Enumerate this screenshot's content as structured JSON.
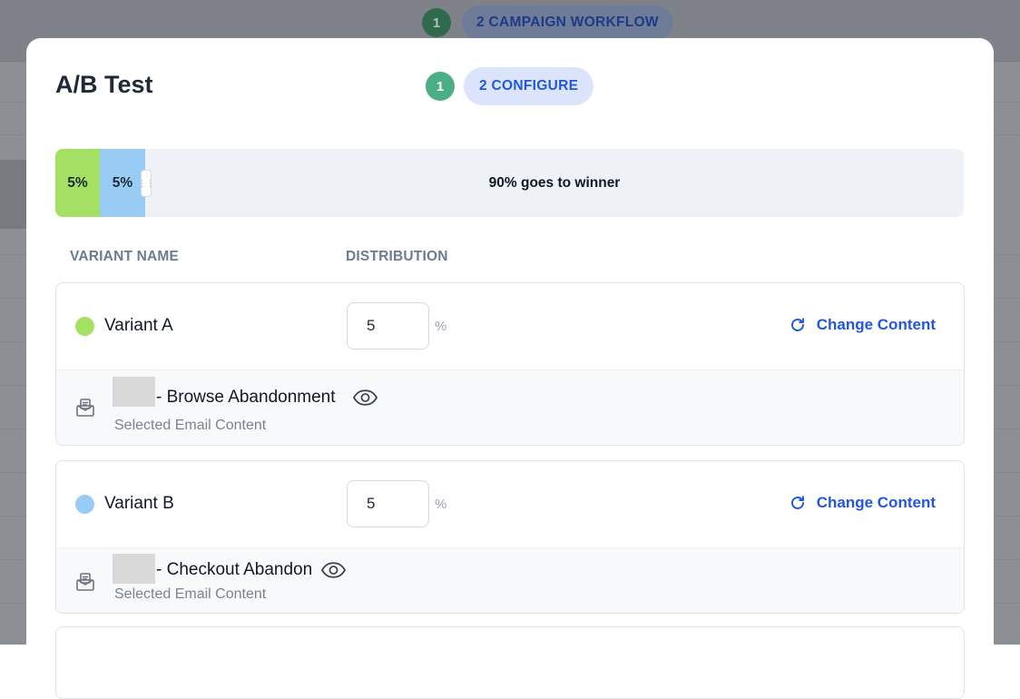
{
  "background": {
    "step_number": "1",
    "step_label": "2 CAMPAIGN WORKFLOW"
  },
  "modal": {
    "title": "A/B Test",
    "step_number": "1",
    "step_label": "2 CONFIGURE"
  },
  "split_bar": {
    "segment_a_label": "5%",
    "segment_b_label": "5%",
    "winner_label": "90% goes to winner",
    "segment_a_share": 5,
    "segment_b_share": 5,
    "winner_share": 90
  },
  "columns": {
    "variant_name": "VARIANT NAME",
    "distribution": "DISTRIBUTION"
  },
  "variants": [
    {
      "name": "Variant A",
      "color": "#a3e063",
      "distribution": "5",
      "unit": "%",
      "change_label": "Change Content",
      "content_name": "- Browse Abandonment",
      "content_caption": "Selected Email Content"
    },
    {
      "name": "Variant B",
      "color": "#99ccf5",
      "distribution": "5",
      "unit": "%",
      "change_label": "Change Content",
      "content_name": "- Checkout Abandon",
      "content_caption": "Selected Email Content"
    }
  ],
  "icons": {
    "refresh": "refresh-icon",
    "email": "email-content-icon",
    "preview": "eye-icon",
    "drag": "drag-handle-icon"
  },
  "colors": {
    "accent": "#2157e0",
    "step_done": "#4cae84",
    "step_active_bg": "#dbe4fb"
  }
}
